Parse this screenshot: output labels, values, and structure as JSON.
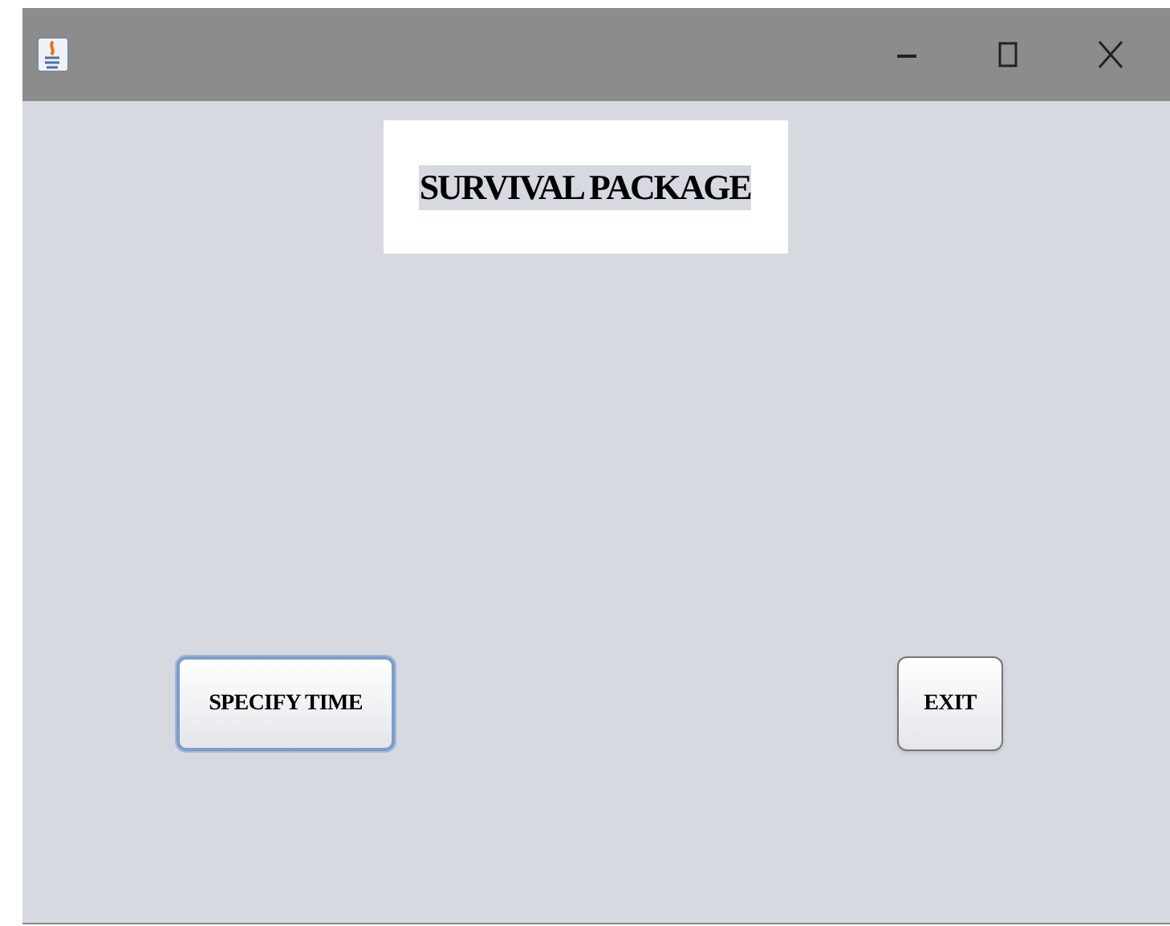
{
  "window": {
    "title_bar": {
      "controls": [
        {
          "kind": "minimize"
        },
        {
          "kind": "maximize"
        },
        {
          "kind": "close"
        }
      ]
    }
  },
  "heading": "SURVIVAL PACKAGE",
  "buttons": [
    {
      "label": "SPECIFY TIME",
      "focused": true
    },
    {
      "label": "EXIT",
      "focused": false
    }
  ]
}
